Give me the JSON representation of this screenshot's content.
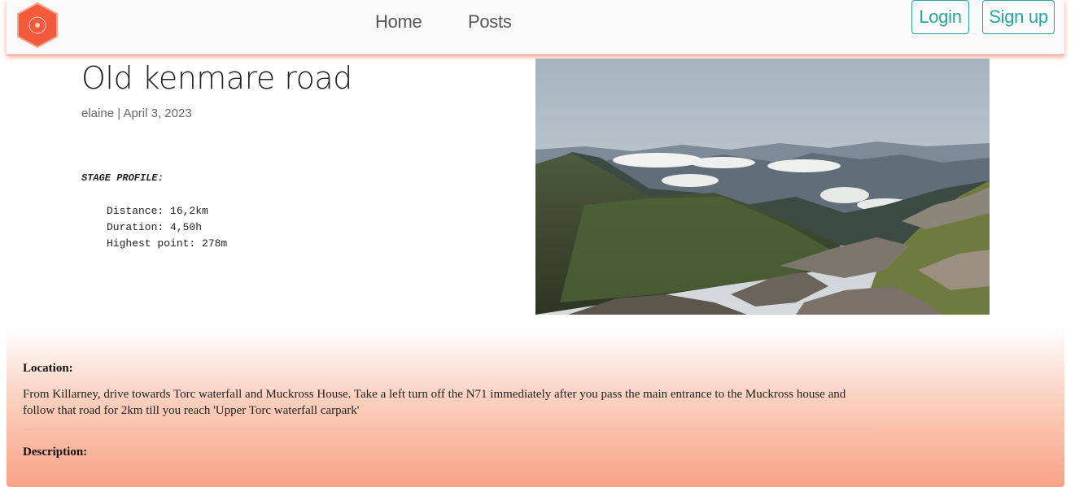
{
  "nav": {
    "home_label": "Home",
    "posts_label": "Posts",
    "login_label": "Login",
    "signup_label": "Sign up"
  },
  "post": {
    "title": "Old kenmare road",
    "meta": "elaine | April 3, 2023",
    "stage_profile_label": "STAGE PROFILE:",
    "distance": "Distance: 16,2km",
    "duration": "Duration: 4,50h",
    "highest_point": "Highest point: 278m"
  },
  "info": {
    "location_label": "Location:",
    "location_text": "From Killarney, drive towards Torc waterfall and Muckross House. Take a left turn off the N71 immediately after you pass the main entrance to the Muckross house and follow that road for 2km till you reach 'Upper Torc waterfall carpark'",
    "description_label": "Description:"
  },
  "colors": {
    "accent": "#2aa6a0",
    "logo": "#f25a3c",
    "panel_bottom": "#f9a284"
  }
}
